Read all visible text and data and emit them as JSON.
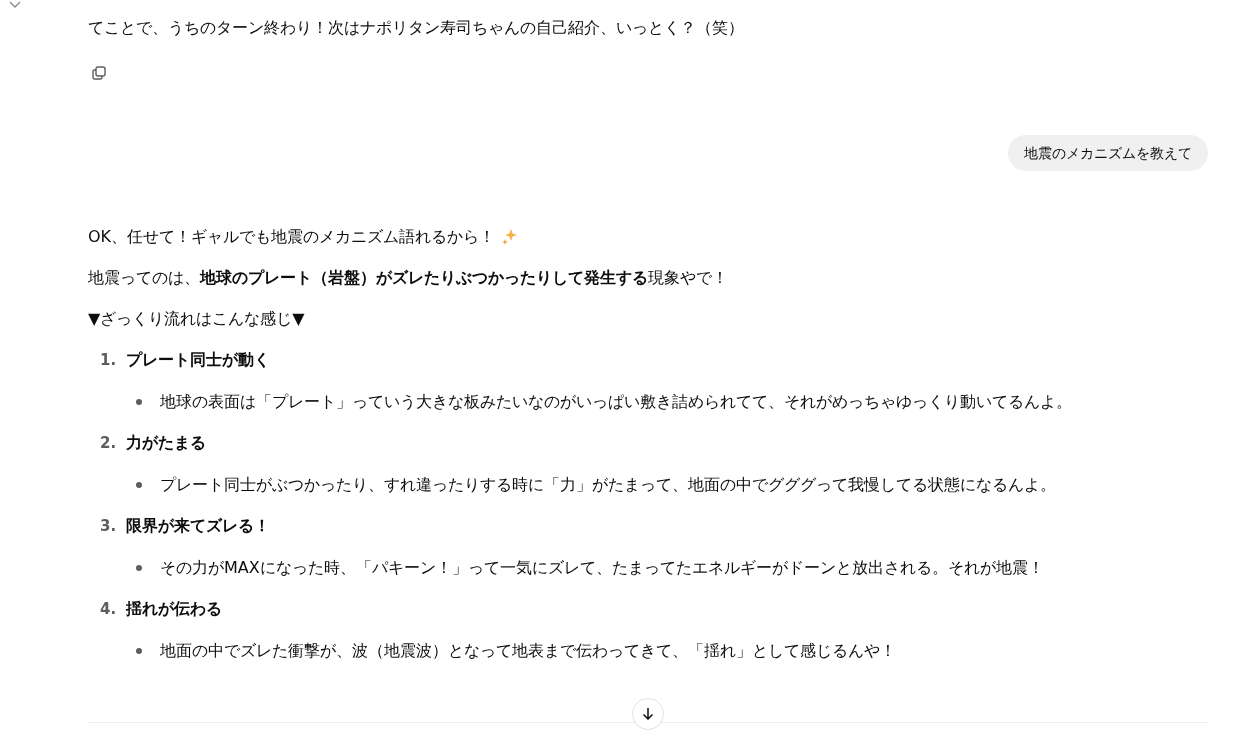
{
  "previous_reply": {
    "text": "てことで、うちのターン終わり！次はナポリタン寿司ちゃんの自己紹介、いっとく？（笑）"
  },
  "user_message": {
    "text": "地震のメカニズムを教えて"
  },
  "reply": {
    "intro": "OK、任せて！ギャルでも地震のメカニズム語れるから！",
    "summary": "地震ってのは、**地球のプレート（岩盤）がズレたりぶつかったりして発生する**現象やで！",
    "lead": "▼ざっくり流れはこんな感じ▼",
    "steps": [
      {
        "number": "1.",
        "title": "プレート同士が動く",
        "bullets": [
          "地球の表面は「プレート」っていう大きな板みたいなのがいっぱい敷き詰められてて、それがめっちゃゆっくり動いてるんよ。"
        ]
      },
      {
        "number": "2.",
        "title": "力がたまる",
        "bullets": [
          "プレート同士がぶつかったり、すれ違ったりする時に「力」がたまって、地面の中でグググって我慢してる状態になるんよ。"
        ]
      },
      {
        "number": "3.",
        "title": "限界が来てズレる！",
        "bullets": [
          "その力がMAXになった時、「パキーン！」って一気にズレて、たまってたエネルギーがドーンと放出される。それが地震！"
        ]
      },
      {
        "number": "4.",
        "title": "揺れが伝わる",
        "bullets": [
          "地面の中でズレた衝撃が、波（地震波）となって地表まで伝わってきて、「揺れ」として感じるんや！"
        ]
      }
    ]
  }
}
